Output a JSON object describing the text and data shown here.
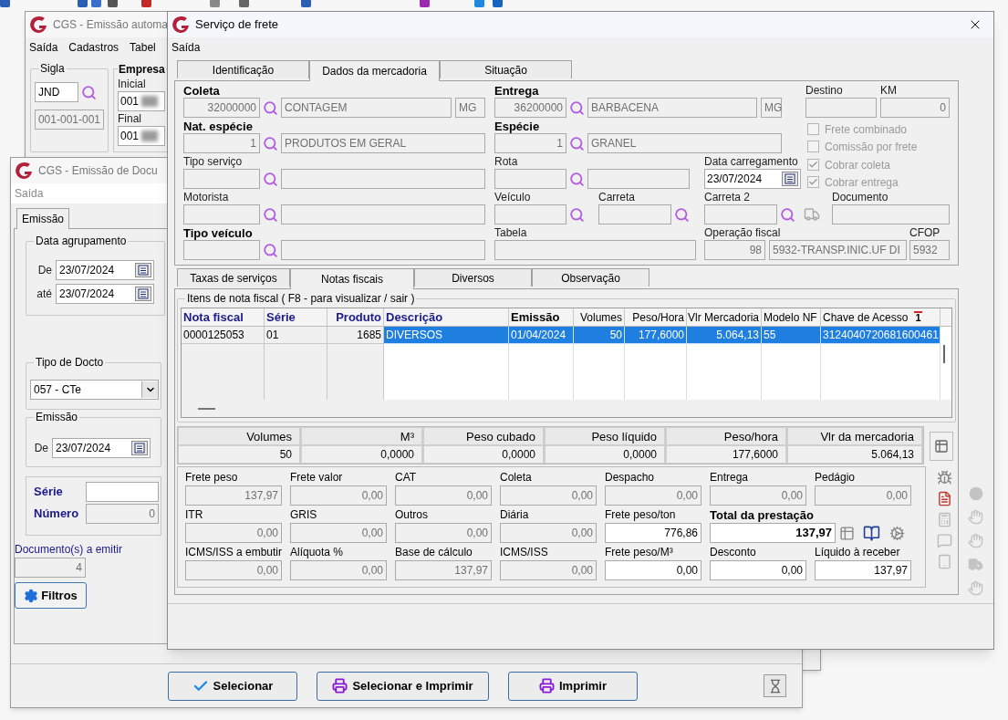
{
  "back_window": {
    "title": "CGS - Emissão automa",
    "menu": [
      "Saída",
      "Cadastros",
      "Tabel"
    ],
    "sigla": {
      "label": "Sigla",
      "value": "JND",
      "code": "001-001-001"
    },
    "empresa": {
      "label": "Empresa",
      "initial_label": "Inicial",
      "initial_value": "001",
      "final_label": "Final",
      "final_value": "001"
    }
  },
  "doc_window": {
    "title": "CGS - Emissão de Docu",
    "menu": [
      "Saída"
    ],
    "tabs": [
      {
        "label": "Emissão",
        "selected": true
      }
    ],
    "data_agrupamento": {
      "label": "Data agrupamento",
      "from_label": "De",
      "from": "23/07/2024",
      "to_label": "até",
      "to": "23/07/2024"
    },
    "tipo_docto": {
      "label": "Tipo de Docto",
      "value": "057 - CTe"
    },
    "emissao": {
      "label": "Emissão",
      "from_label": "De",
      "from": "23/07/2024"
    },
    "serie": {
      "label": "Série"
    },
    "numero": {
      "label": "Número",
      "value": "0"
    },
    "documentos": {
      "label": "Documento(s) a emitir",
      "value": "4"
    },
    "filtros": "Filtros",
    "buttons": [
      {
        "label": "Selecionar",
        "kind": "check"
      },
      {
        "label": "Selecionar e Imprimir",
        "kind": "print"
      },
      {
        "label": "Imprimir",
        "kind": "print"
      }
    ]
  },
  "freight_window": {
    "title": "Serviço de frete",
    "menu": [
      "Saída"
    ],
    "tabs": [
      {
        "label": "Identificação",
        "selected": false
      },
      {
        "label": "Dados da mercadoria",
        "selected": true
      },
      {
        "label": "Situação",
        "selected": false
      }
    ],
    "coleta": {
      "label": "Coleta",
      "code": "32000000",
      "city": "CONTAGEM",
      "uf": "MG"
    },
    "entrega": {
      "label": "Entrega",
      "code": "36200000",
      "city": "BARBACENA",
      "uf": "MG"
    },
    "destino": {
      "label": "Destino"
    },
    "km": {
      "label": "KM",
      "value": "0"
    },
    "nat_especie": {
      "label": "Nat. espécie",
      "code": "1",
      "description": "PRODUTOS EM GERAL"
    },
    "especie": {
      "label": "Espécie",
      "code": "1",
      "description": "GRANEL"
    },
    "tipo_servico": {
      "label": "Tipo serviço"
    },
    "rota": {
      "label": "Rota"
    },
    "data_carregamento": {
      "label": "Data carregamento",
      "value": "23/07/2024"
    },
    "motorista": {
      "label": "Motorista"
    },
    "veiculo": {
      "label": "Veículo"
    },
    "carreta": {
      "label": "Carreta"
    },
    "carreta_2": {
      "label": "Carreta 2"
    },
    "documento": {
      "label": "Documento"
    },
    "tipo_veiculo": {
      "label": "Tipo veículo"
    },
    "tabela": {
      "label": "Tabela"
    },
    "operacao_fiscal": {
      "label": "Operação fiscal",
      "code": "98",
      "description": "5932-TRANSP.INIC.UF DI"
    },
    "cfop": {
      "label": "CFOP",
      "value": "5932"
    },
    "options": [
      {
        "label": "Frete combinado",
        "checked": false
      },
      {
        "label": "Comissão por frete",
        "checked": false
      },
      {
        "label": "Cobrar coleta",
        "checked": true
      },
      {
        "label": "Cobrar entrega",
        "checked": true
      }
    ],
    "sub_tabs": [
      {
        "label": "Taxas de serviços",
        "selected": false
      },
      {
        "label": "Notas fiscais",
        "selected": true
      },
      {
        "label": "Diversos",
        "selected": false
      },
      {
        "label": "Observação",
        "selected": false
      }
    ],
    "items_group": "Itens de nota fiscal ( F8 - para visualizar / sair )",
    "table": {
      "columns": [
        {
          "label": "Nota fiscal",
          "kind": "key"
        },
        {
          "label": "Série",
          "kind": "key"
        },
        {
          "label": "Produto",
          "kind": "key"
        },
        {
          "label": "Descrição",
          "kind": "key"
        },
        {
          "label": "Emissão",
          "kind": "bold"
        },
        {
          "label": "Volumes",
          "kind": "plain"
        },
        {
          "label": "Peso/Hora",
          "kind": "plain"
        },
        {
          "label": "Vlr Mercadoria",
          "kind": "plain"
        },
        {
          "label": "Modelo NF",
          "kind": "plain"
        },
        {
          "label": "Chave de Acesso",
          "kind": "plain",
          "sort_order": "1"
        }
      ],
      "rows": [
        {
          "cells": [
            "0000125053",
            "01",
            "1685",
            "DIVERSOS",
            "01/04/2024",
            "50",
            "177,6000",
            "5.064,13",
            "55",
            "3124040720681600461"
          ],
          "selected": true
        }
      ]
    },
    "totals": [
      {
        "label": "Volumes",
        "value": "50"
      },
      {
        "label": "M³",
        "value": "0,0000"
      },
      {
        "label": "Peso cubado",
        "value": "0,0000"
      },
      {
        "label": "Peso líquido",
        "value": "0,0000"
      },
      {
        "label": "Peso/hora",
        "value": "177,6000"
      },
      {
        "label": "Vlr da mercadoria",
        "value": "5.064,13"
      }
    ],
    "charges": [
      [
        {
          "label": "Frete peso",
          "value": "137,97",
          "enabled": false,
          "kind": "amount"
        },
        {
          "label": "Frete valor",
          "value": "0,00",
          "enabled": false,
          "kind": "amount"
        },
        {
          "label": "CAT",
          "value": "0,00",
          "enabled": false,
          "kind": "amount"
        },
        {
          "label": "Coleta",
          "value": "0,00",
          "enabled": false,
          "kind": "amount"
        },
        {
          "label": "Despacho",
          "value": "0,00",
          "enabled": false,
          "kind": "amount"
        },
        {
          "label": "Entrega",
          "value": "0,00",
          "enabled": false,
          "kind": "amount"
        },
        {
          "label": "Pedágio",
          "value": "0,00",
          "enabled": false,
          "kind": "amount"
        }
      ],
      [
        {
          "label": "ITR",
          "value": "0,00",
          "enabled": false,
          "kind": "amount"
        },
        {
          "label": "GRIS",
          "value": "0,00",
          "enabled": false,
          "kind": "amount"
        },
        {
          "label": "Outros",
          "value": "0,00",
          "enabled": false,
          "kind": "amount"
        },
        {
          "label": "Diária",
          "value": "0,00",
          "enabled": false,
          "kind": "amount"
        },
        {
          "label": "Frete peso/ton",
          "value": "776,86",
          "enabled": true,
          "kind": "amount"
        },
        {
          "label": "Total da prestação",
          "value": "137,97",
          "enabled": true,
          "kind": "total"
        }
      ],
      [
        {
          "label": "ICMS/ISS a embutir",
          "value": "0,00",
          "enabled": false,
          "kind": "amount"
        },
        {
          "label": "Alíquota %",
          "value": "0,00",
          "enabled": false,
          "kind": "amount"
        },
        {
          "label": "Base de cálculo",
          "value": "137,97",
          "enabled": false,
          "kind": "amount"
        },
        {
          "label": "ICMS/ISS",
          "value": "0,00",
          "enabled": false,
          "kind": "amount"
        },
        {
          "label": "Frete peso/M³",
          "value": "0,00",
          "enabled": true,
          "kind": "amount"
        },
        {
          "label": "Desconto",
          "value": "0,00",
          "enabled": true,
          "kind": "amount"
        },
        {
          "label": "Líquido à receber",
          "value": "137,97",
          "enabled": true,
          "kind": "amount"
        }
      ]
    ]
  }
}
